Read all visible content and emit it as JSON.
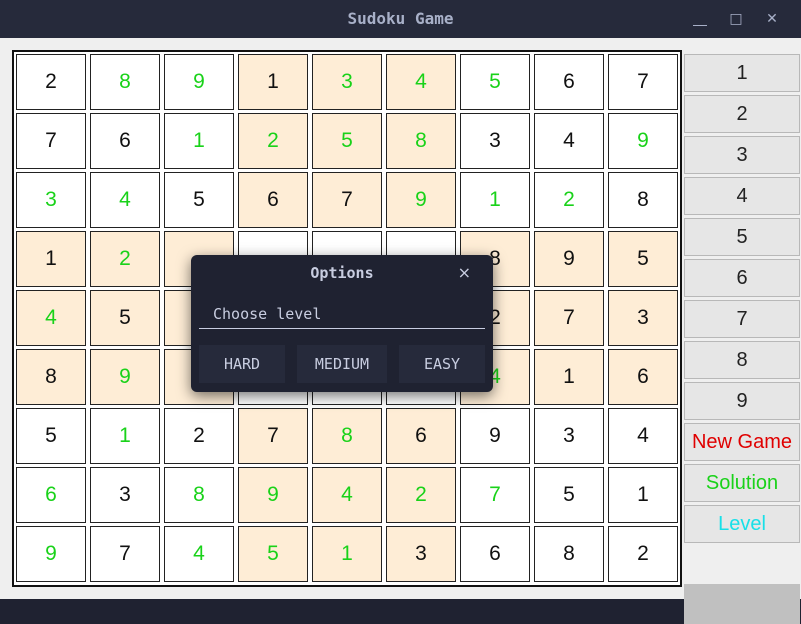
{
  "window": {
    "title": "Sudoku Game",
    "minimize_glyph": "⎽",
    "maximize_glyph": "□",
    "close_glyph": "✕"
  },
  "colors": {
    "given": "#111111",
    "filled": "#19d219",
    "shaded_box": "#feedd6",
    "new_game": "#e00000",
    "solution": "#19d219",
    "level": "#18e0e8"
  },
  "board": {
    "rows": [
      [
        {
          "v": "2",
          "t": "g"
        },
        {
          "v": "8",
          "t": "f"
        },
        {
          "v": "9",
          "t": "f"
        },
        {
          "v": "1",
          "t": "g"
        },
        {
          "v": "3",
          "t": "f"
        },
        {
          "v": "4",
          "t": "f"
        },
        {
          "v": "5",
          "t": "f"
        },
        {
          "v": "6",
          "t": "g"
        },
        {
          "v": "7",
          "t": "g"
        }
      ],
      [
        {
          "v": "7",
          "t": "g"
        },
        {
          "v": "6",
          "t": "g"
        },
        {
          "v": "1",
          "t": "f"
        },
        {
          "v": "2",
          "t": "f"
        },
        {
          "v": "5",
          "t": "f"
        },
        {
          "v": "8",
          "t": "f"
        },
        {
          "v": "3",
          "t": "g"
        },
        {
          "v": "4",
          "t": "g"
        },
        {
          "v": "9",
          "t": "f"
        }
      ],
      [
        {
          "v": "3",
          "t": "f"
        },
        {
          "v": "4",
          "t": "f"
        },
        {
          "v": "5",
          "t": "g"
        },
        {
          "v": "6",
          "t": "g"
        },
        {
          "v": "7",
          "t": "g"
        },
        {
          "v": "9",
          "t": "f"
        },
        {
          "v": "1",
          "t": "f"
        },
        {
          "v": "2",
          "t": "f"
        },
        {
          "v": "8",
          "t": "g"
        }
      ],
      [
        {
          "v": "1",
          "t": "g"
        },
        {
          "v": "2",
          "t": "f"
        },
        {
          "v": "",
          "t": "f"
        },
        {
          "v": "",
          "t": "g"
        },
        {
          "v": "",
          "t": "f"
        },
        {
          "v": "",
          "t": "g"
        },
        {
          "v": "8",
          "t": "g"
        },
        {
          "v": "9",
          "t": "g"
        },
        {
          "v": "5",
          "t": "g"
        }
      ],
      [
        {
          "v": "4",
          "t": "f"
        },
        {
          "v": "5",
          "t": "g"
        },
        {
          "v": "",
          "t": "g"
        },
        {
          "v": "",
          "t": "g"
        },
        {
          "v": "",
          "t": "g"
        },
        {
          "v": "",
          "t": "g"
        },
        {
          "v": "2",
          "t": "g"
        },
        {
          "v": "7",
          "t": "g"
        },
        {
          "v": "3",
          "t": "g"
        }
      ],
      [
        {
          "v": "8",
          "t": "g"
        },
        {
          "v": "9",
          "t": "f"
        },
        {
          "v": "",
          "t": "g"
        },
        {
          "v": "",
          "t": "g"
        },
        {
          "v": "",
          "t": "g"
        },
        {
          "v": "",
          "t": "g"
        },
        {
          "v": "4",
          "t": "f"
        },
        {
          "v": "1",
          "t": "g"
        },
        {
          "v": "6",
          "t": "g"
        }
      ],
      [
        {
          "v": "5",
          "t": "g"
        },
        {
          "v": "1",
          "t": "f"
        },
        {
          "v": "2",
          "t": "g"
        },
        {
          "v": "7",
          "t": "g"
        },
        {
          "v": "8",
          "t": "f"
        },
        {
          "v": "6",
          "t": "g"
        },
        {
          "v": "9",
          "t": "g"
        },
        {
          "v": "3",
          "t": "g"
        },
        {
          "v": "4",
          "t": "g"
        }
      ],
      [
        {
          "v": "6",
          "t": "f"
        },
        {
          "v": "3",
          "t": "g"
        },
        {
          "v": "8",
          "t": "f"
        },
        {
          "v": "9",
          "t": "f"
        },
        {
          "v": "4",
          "t": "f"
        },
        {
          "v": "2",
          "t": "f"
        },
        {
          "v": "7",
          "t": "f"
        },
        {
          "v": "5",
          "t": "g"
        },
        {
          "v": "1",
          "t": "g"
        }
      ],
      [
        {
          "v": "9",
          "t": "f"
        },
        {
          "v": "7",
          "t": "g"
        },
        {
          "v": "4",
          "t": "f"
        },
        {
          "v": "5",
          "t": "f"
        },
        {
          "v": "1",
          "t": "f"
        },
        {
          "v": "3",
          "t": "g"
        },
        {
          "v": "6",
          "t": "g"
        },
        {
          "v": "8",
          "t": "g"
        },
        {
          "v": "2",
          "t": "g"
        }
      ]
    ]
  },
  "side_panel": {
    "number_buttons": [
      "1",
      "2",
      "3",
      "4",
      "5",
      "6",
      "7",
      "8",
      "9"
    ],
    "new_game": "New Game",
    "solution": "Solution",
    "level": "Level"
  },
  "dialog": {
    "title": "Options",
    "close_glyph": "×",
    "placeholder": "Choose level",
    "buttons": [
      "HARD",
      "MEDIUM",
      "EASY"
    ]
  }
}
